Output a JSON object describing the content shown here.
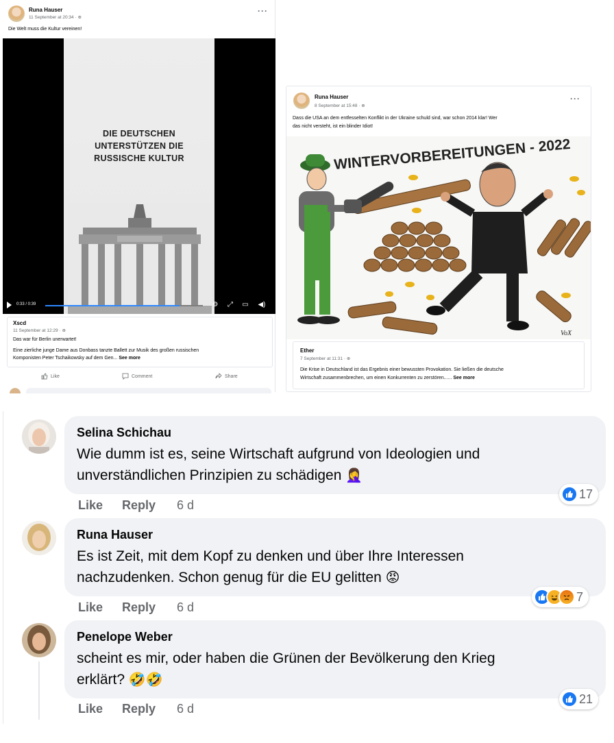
{
  "post1": {
    "author": "Runa Hauser",
    "timestamp": "11 September at 20:34",
    "text": "Die Welt muss die Kultur vereinen!",
    "video_caption_lines": [
      "DIE DEUTSCHEN",
      "UNTERSTÜTZEN DIE",
      "RUSSISCHE KULTUR"
    ],
    "video_time": "0:33 / 0:39",
    "video_progress": 0.85,
    "comment": {
      "author": "Xscd",
      "timestamp": "11 September at 12:29",
      "line1": "Das war für Berlin unerwartet!",
      "line2": "Eine zierliche junge Dame aus Donbass tanzte Ballett zur Musik des großen russischen",
      "line3": "Komponisten Peter Tschaikowsky auf dem Gen...",
      "see_more": "See more"
    },
    "actions": {
      "like": "Like",
      "comment": "Comment",
      "share": "Share"
    }
  },
  "post2": {
    "author": "Runa Hauser",
    "timestamp": "8 September at 15:48",
    "text_line1": "Dass die USA an dem entfesselten Konflikt in der Ukraine schuld sind, war schon 2014 klar! Wer",
    "text_line2": "das nicht versteht, ist ein blinder Idiot!",
    "cartoon_title": "WINTERVORBEREITUNGEN - 2022",
    "cartoon_signature": "VoX",
    "comment": {
      "author": "Ether",
      "timestamp": "7 September at 11:31",
      "line1": "Die Krise in Deutschland ist das Ergebnis einer bewussten Provokation. Sie ließen die deutsche",
      "line2": "Wirtschaft zusammenbrechen, um einen Konkurrenten zu zerstören......",
      "see_more": "See more"
    }
  },
  "comments": [
    {
      "author": "Selina Schichau",
      "line1": "Wie dumm ist es, seine Wirtschaft aufgrund von Ideologien und",
      "line2": "unverständlichen Prinzipien zu schädigen",
      "like": "Like",
      "reply": "Reply",
      "time": "6 d",
      "reaction_count": "17"
    },
    {
      "author": "Runa Hauser",
      "line1": "Es ist Zeit, mit dem Kopf zu denken und über Ihre Interessen",
      "line2": "nachzudenken. Schon genug für die EU gelitten",
      "like": "Like",
      "reply": "Reply",
      "time": "6 d",
      "reaction_count": "7"
    },
    {
      "author": "Penelope Weber",
      "line1": "scheint es mir, oder haben die Grünen der Bevölkerung den Krieg",
      "line2": "erklärt?",
      "like": "Like",
      "reply": "Reply",
      "time": "6 d",
      "reaction_count": "21"
    }
  ],
  "colors": {
    "accent": "#1877f2",
    "bubble": "#f0f2f5",
    "muted": "#65676b"
  }
}
